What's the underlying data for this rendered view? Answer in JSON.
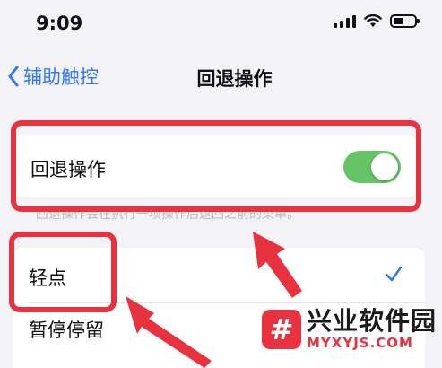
{
  "status_bar": {
    "time": "9:09"
  },
  "nav": {
    "back_label": "辅助触控",
    "title": "回退操作"
  },
  "toggle_row": {
    "label": "回退操作",
    "enabled": true
  },
  "footnote": "回退操作会在执行一项操作后返回之前的菜单。",
  "options": [
    {
      "label": "轻点",
      "selected": true
    },
    {
      "label": "暂停停留",
      "selected": false
    }
  ],
  "watermark": {
    "logo_char": "#",
    "name": "兴业软件园",
    "url": "MYXYJS.COM"
  },
  "colors": {
    "accent": "#3478f6",
    "toggle_on": "#65c466",
    "highlight": "#e8323f"
  }
}
